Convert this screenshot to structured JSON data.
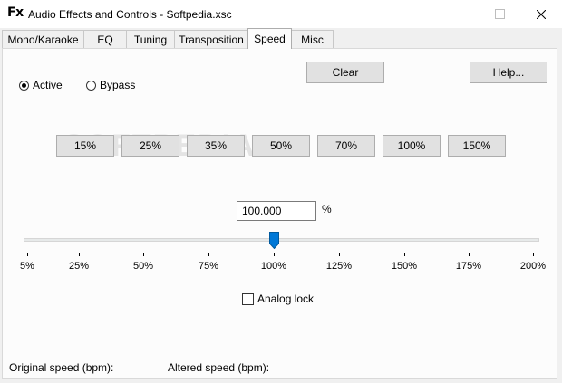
{
  "window": {
    "icon_label": "Fx",
    "title": "Audio Effects and Controls - Softpedia.xsc"
  },
  "tabs": [
    {
      "label": "Mono/Karaoke"
    },
    {
      "label": "EQ"
    },
    {
      "label": "Tuning"
    },
    {
      "label": "Transposition"
    },
    {
      "label": "Speed"
    },
    {
      "label": "Misc"
    }
  ],
  "active_tab": "Speed",
  "mode": {
    "active_label": "Active",
    "bypass_label": "Bypass",
    "selected": "Active"
  },
  "buttons": {
    "clear_label": "Clear",
    "help_label": "Help..."
  },
  "presets": [
    "15%",
    "25%",
    "35%",
    "50%",
    "70%",
    "100%",
    "150%"
  ],
  "speed": {
    "value": "100.000",
    "unit": "%",
    "slider_value_percent": 100
  },
  "scale": [
    "5%",
    "25%",
    "50%",
    "75%",
    "100%",
    "125%",
    "150%",
    "175%",
    "200%"
  ],
  "analog_lock": {
    "label": "Analog lock",
    "checked": false
  },
  "footer": {
    "original_label": "Original speed (bpm):",
    "altered_label": "Altered speed (bpm):"
  }
}
